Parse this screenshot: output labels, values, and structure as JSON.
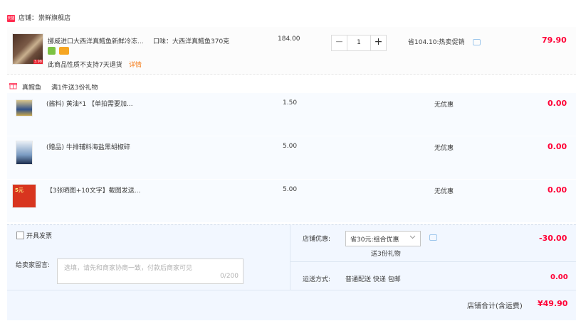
{
  "store": {
    "badge": "天猫",
    "label": "店铺：",
    "name": "崇鲜旗舰店"
  },
  "main_item": {
    "title": "挪威进口大西洋真鳕鱼新鲜冷冻...",
    "spec": "口味：大西洋真鳕鱼370克",
    "unit_price": "184.00",
    "quantity": "1",
    "minus": "−",
    "plus": "+",
    "promo": "省104.10:热卖促销",
    "subtotal": "79.90",
    "notice": "此商品性质不支持7天退货",
    "detail_link": "详情",
    "thumb_tag": "3.98"
  },
  "gift_group": {
    "tag": "真鳕鱼",
    "desc": "满1件送3份礼物",
    "items": [
      {
        "title": "(酱料) 黄油*1 【单拍需要加...",
        "price": "1.50",
        "promo": "无优惠",
        "subtotal": "0.00"
      },
      {
        "title": "(赠品) 牛排辅料海盐黑胡椒碎",
        "price": "5.00",
        "promo": "无优惠",
        "subtotal": "0.00"
      },
      {
        "title": "【3张晒图+10文字】截图发送...",
        "price": "5.00",
        "promo": "无优惠",
        "subtotal": "0.00",
        "thumb_tag": "5元"
      }
    ]
  },
  "invoice": {
    "label": "开具发票"
  },
  "memo": {
    "label": "给卖家留言:",
    "placeholder": "选填，请先和商家协商一致，付款后商家可见",
    "count": "0/200"
  },
  "store_discount": {
    "label": "店铺优惠:",
    "selected": "省30元:组合优惠",
    "note": "送3份礼物",
    "amount": "-30.00"
  },
  "shipping": {
    "label": "运送方式:",
    "method": "普通配送 快递 包邮",
    "amount": "0.00"
  },
  "total": {
    "label": "店铺合计(含运费)",
    "amount": "¥49.90"
  },
  "colors": {
    "accent_red": "#ff0036",
    "link_orange": "#f57b17",
    "bottom_bg": "#f2f7ff"
  }
}
